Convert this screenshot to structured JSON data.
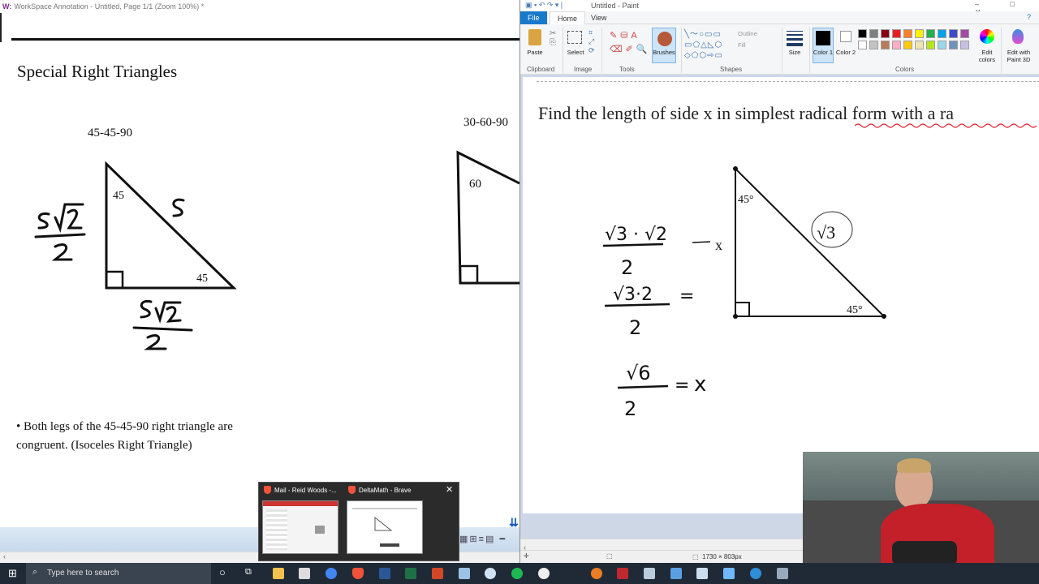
{
  "workspace": {
    "title": "WorkSpace Annotation - Untitled, Page 1/1 (Zoom 100%) *",
    "heading": "Special Right Triangles",
    "triangle_4545": {
      "label": "45-45-90",
      "angle_top": "45",
      "angle_right": "45",
      "hyp": "S",
      "leg_left": "S√2 / 2",
      "leg_bottom": "S√2 / 2"
    },
    "triangle_3060": {
      "label": "30-60-90",
      "angle_top": "60"
    },
    "bullet": "• Both legs of the 45-45-90 right triangle are congruent. (Isoceles Right Triangle)"
  },
  "thumbnails": [
    {
      "title": "Mail - Reid Woods -..."
    },
    {
      "title": "DeltaMath - Brave"
    }
  ],
  "paint": {
    "title": "Untitled - Paint",
    "tabs": [
      "File",
      "Home",
      "View"
    ],
    "groups": {
      "clipboard": "Clipboard",
      "image": "Image",
      "tools": "Tools",
      "shapes": "Shapes",
      "colors": "Colors"
    },
    "buttons": {
      "paste": "Paste",
      "select": "Select",
      "brushes": "Brushes",
      "outline": "Outline",
      "fill": "Fill",
      "size": "Size",
      "color1": "Color 1",
      "color2": "Color 2",
      "edit_colors": "Edit colors",
      "edit_3d": "Edit with Paint 3D"
    },
    "palette": [
      "#000000",
      "#7f7f7f",
      "#880015",
      "#ed1c24",
      "#ff7f27",
      "#fff200",
      "#22b14c",
      "#00a2e8",
      "#3f48cc",
      "#a349a4",
      "#ffffff",
      "#c3c3c3",
      "#b97a57",
      "#ffaec9",
      "#ffc90e",
      "#efe4b0",
      "#b5e61d",
      "#99d9ea",
      "#7092be",
      "#c8bfe7"
    ],
    "question": "Find the length of side x in simplest radical form with a ra",
    "triangle": {
      "angle_top": "45°",
      "angle_right": "45°",
      "hyp": "√3",
      "leg": "x"
    },
    "work": {
      "step1_num": "√3 · √2",
      "step1_den": "2",
      "step2_num": "√3·2",
      "step2_den": "2",
      "step3_num": "√6",
      "step3_den": "2",
      "result_var": "x"
    },
    "status_size": "1730 × 803px"
  },
  "taskbar": {
    "search_placeholder": "Type here to search"
  }
}
